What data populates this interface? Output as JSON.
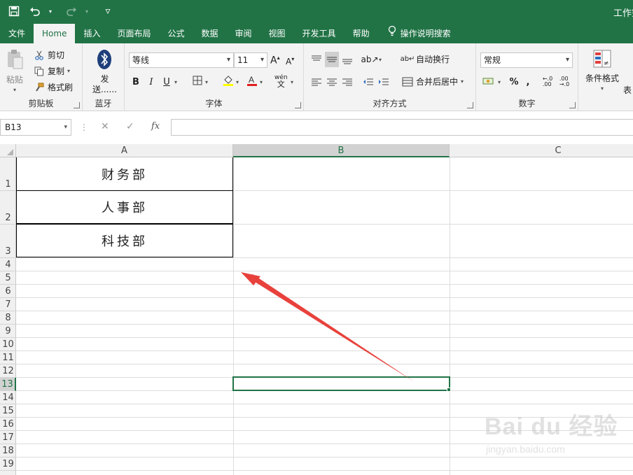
{
  "window": {
    "title": "工作簿"
  },
  "qat": {
    "customize_glyph": "▿"
  },
  "tabs": [
    {
      "label": "文件"
    },
    {
      "label": "Home"
    },
    {
      "label": "插入"
    },
    {
      "label": "页面布局"
    },
    {
      "label": "公式"
    },
    {
      "label": "数据"
    },
    {
      "label": "审阅"
    },
    {
      "label": "视图"
    },
    {
      "label": "开发工具"
    },
    {
      "label": "帮助"
    }
  ],
  "tell_me": {
    "label": "操作说明搜索"
  },
  "ribbon": {
    "clipboard": {
      "label": "剪贴板",
      "paste": "粘贴",
      "cut": "剪切",
      "copy": "复制",
      "format_painter": "格式刷"
    },
    "bluetooth": {
      "label": "蓝牙",
      "send_line1": "发",
      "send_line2": "送......"
    },
    "font": {
      "label": "字体",
      "font_name": "等线",
      "font_size": "11",
      "bold": "B",
      "italic": "I",
      "underline": "U",
      "wen": "wén",
      "wen_char": "文"
    },
    "alignment": {
      "label": "对齐方式",
      "wrap_text": "自动换行",
      "merge_center": "合并后居中"
    },
    "number": {
      "label": "数字",
      "format": "常规",
      "percent": "%",
      "comma": ","
    },
    "styles": {
      "conditional_format": "条件格式",
      "table_format_partial": "表"
    }
  },
  "formula_bar": {
    "name_box": "B13",
    "fx": "fx",
    "value": ""
  },
  "columns": [
    "A",
    "B",
    "C"
  ],
  "rows": [
    "1",
    "2",
    "3",
    "4",
    "5",
    "6",
    "7",
    "8",
    "9",
    "10",
    "11",
    "12",
    "13",
    "14",
    "15",
    "16",
    "17",
    "18",
    "19"
  ],
  "cells": {
    "A1": "财务部",
    "A2": "人事部",
    "A3": "科技部"
  },
  "selection": {
    "cell": "B13",
    "column": "B",
    "row": "13"
  },
  "colors": {
    "accent": "#217346",
    "arrow": "#e8413c"
  },
  "watermark": {
    "main": "Bai du 经验",
    "sub": "jingyan.baidu.com"
  }
}
